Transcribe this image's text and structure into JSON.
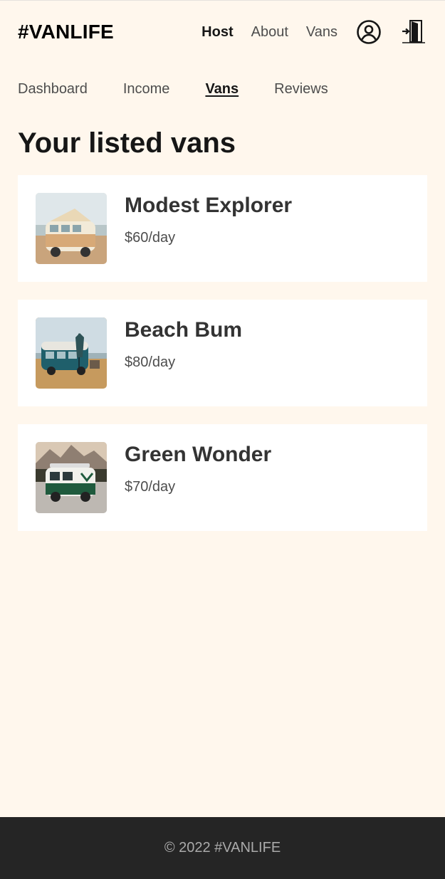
{
  "header": {
    "logo": "#VANLIFE",
    "nav": [
      "Host",
      "About",
      "Vans"
    ],
    "icons": [
      "user-circle-icon",
      "logout-door-icon"
    ]
  },
  "host_nav": [
    "Dashboard",
    "Income",
    "Vans",
    "Reviews"
  ],
  "page_title": "Your listed vans",
  "vans": [
    {
      "name": "Modest Explorer",
      "price": "$60/day"
    },
    {
      "name": "Beach Bum",
      "price": "$80/day"
    },
    {
      "name": "Green Wonder",
      "price": "$70/day"
    }
  ],
  "footer": {
    "text": "© 2022 #VANLIFE"
  },
  "colors": {
    "page_background": "#FFF7ED",
    "card_background": "#FFFFFF",
    "footer_background": "#252525"
  }
}
